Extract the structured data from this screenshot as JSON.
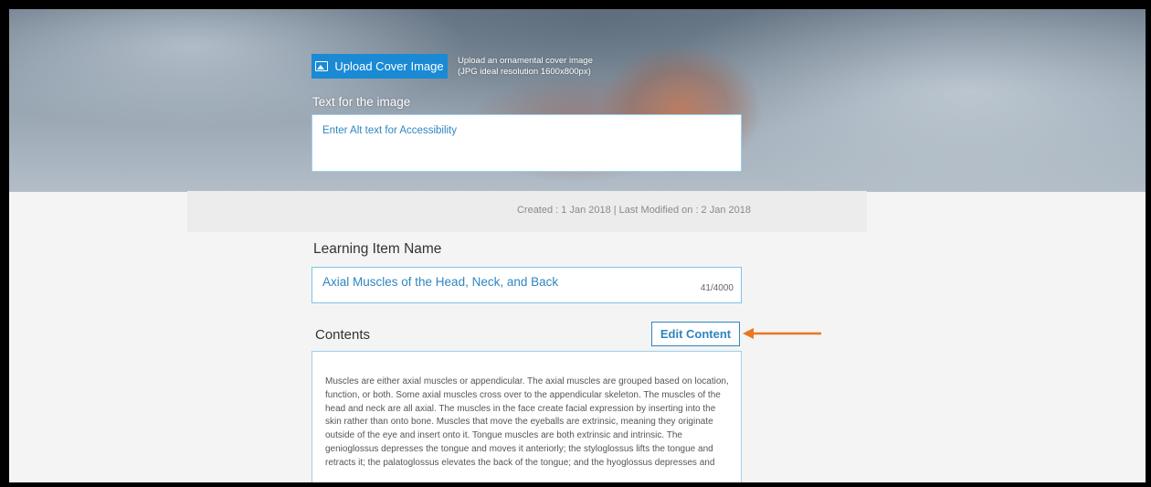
{
  "cover": {
    "upload_button_label": "Upload Cover Image",
    "upload_hint_line1": "Upload an ornamental cover image",
    "upload_hint_line2": "(JPG ideal resolution 1600x800px)",
    "alt_label": "Text for the image",
    "alt_placeholder": "Enter Alt text for Accessibility"
  },
  "meta": {
    "text": "Created : 1 Jan 2018 |  Last Modified on : 2 Jan 2018"
  },
  "learning_item": {
    "label": "Learning Item Name",
    "value": "Axial Muscles of the Head, Neck, and Back",
    "char_count": "41/4000"
  },
  "contents": {
    "label": "Contents",
    "edit_button_label": "Edit Content",
    "body": "Muscles are either axial muscles or appendicular. The axial muscles are grouped based on location, function, or both. Some axial muscles cross over to the appendicular skeleton. The muscles of the head and neck are all axial. The muscles in the face create facial expression by inserting into the skin rather than onto bone. Muscles that move the eyeballs are extrinsic, meaning they originate outside of the eye and insert onto it. Tongue muscles are both extrinsic and intrinsic. The genioglossus depresses the tongue and moves it anteriorly; the styloglossus lifts the tongue and retracts it; the palatoglossus elevates the back of the tongue; and the hyoglossus depresses and"
  },
  "colors": {
    "accent": "#1a8ad4",
    "link_text": "#2e86c1",
    "annotation_arrow": "#e87722"
  },
  "icons": {
    "upload": "image-icon",
    "annotation": "arrow-left-icon"
  }
}
